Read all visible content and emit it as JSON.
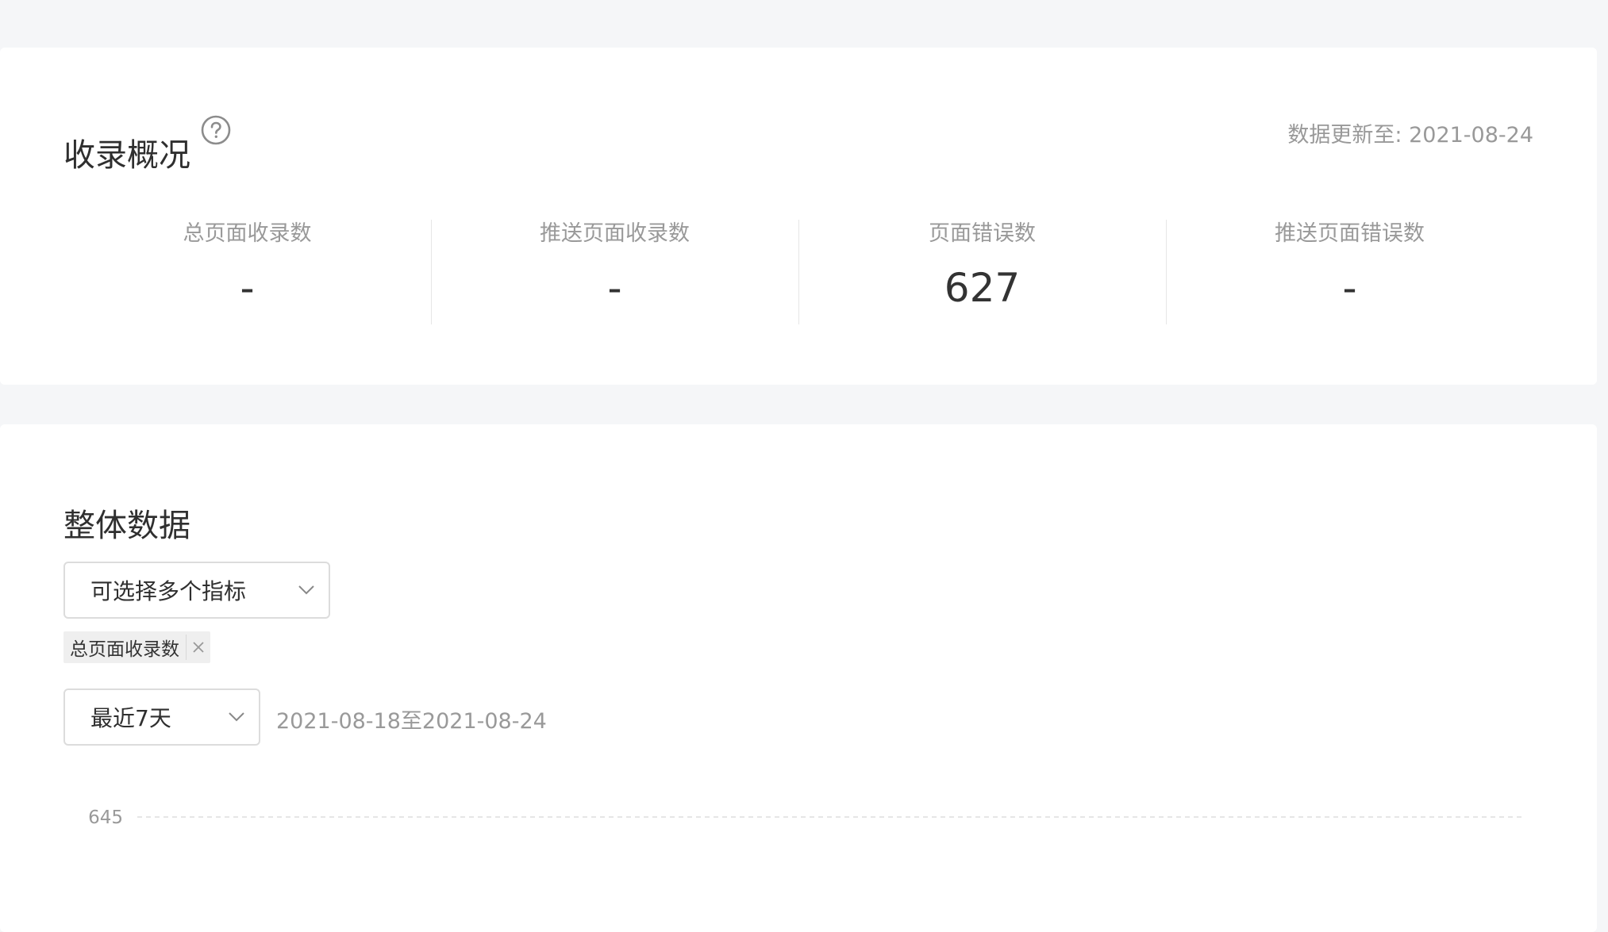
{
  "overview": {
    "title": "收录概况",
    "help_icon": "question-circle-icon",
    "update_text": "数据更新至: 2021-08-24",
    "stats": [
      {
        "label": "总页面收录数",
        "value": "-"
      },
      {
        "label": "推送页面收录数",
        "value": "-"
      },
      {
        "label": "页面错误数",
        "value": "627"
      },
      {
        "label": "推送页面错误数",
        "value": "-"
      }
    ]
  },
  "overall": {
    "title": "整体数据",
    "metric_select": {
      "placeholder": "可选择多个指标",
      "icon": "chevron-down-icon"
    },
    "selected_tags": [
      {
        "label": "总页面收录数",
        "close_icon": "close-icon"
      }
    ],
    "range_select": {
      "value": "最近7天",
      "icon": "chevron-down-icon"
    },
    "date_range": "2021-08-18至2021-08-24"
  },
  "chart_data": {
    "type": "line",
    "y_ticks": [
      "645"
    ],
    "grid": "dashed horizontal"
  }
}
